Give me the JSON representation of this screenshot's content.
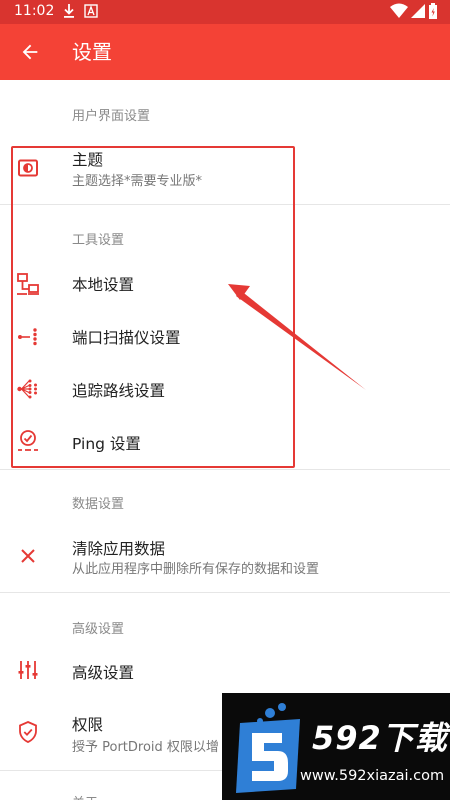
{
  "status_bar": {
    "time": "11:02",
    "background_color": "#d9342f",
    "left_icons": [
      "download-icon",
      "font-a-icon"
    ],
    "right_icons": [
      "wifi-icon",
      "signal-icon",
      "battery-icon"
    ]
  },
  "app_bar": {
    "title": "设置",
    "back_icon": "arrow-back-icon",
    "color": "#f44236"
  },
  "accent_color": "#e53935",
  "sections": {
    "ui": {
      "header": "用户界面设置",
      "theme": {
        "title": "主题",
        "summary": "主题选择*需要专业版*",
        "icon": "theme-icon"
      }
    },
    "tools": {
      "header": "工具设置",
      "local": {
        "title": "本地设置",
        "icon": "network-icon"
      },
      "port_scanner": {
        "title": "端口扫描仪设置",
        "icon": "port-scan-icon"
      },
      "traceroute": {
        "title": "追踪路线设置",
        "icon": "traceroute-icon"
      },
      "ping": {
        "title": "Ping 设置",
        "icon": "ping-icon"
      }
    },
    "data": {
      "header": "数据设置",
      "clear": {
        "title": "清除应用数据",
        "summary": "从此应用程序中删除所有保存的数据和设置",
        "icon": "close-icon"
      }
    },
    "advanced": {
      "header": "高级设置",
      "advanced_item": {
        "title": "高级设置",
        "icon": "sliders-icon"
      },
      "permissions": {
        "title": "权限",
        "summary": "授予 PortDroid 权限以增",
        "icon": "shield-check-icon"
      }
    },
    "about": {
      "header": "关于"
    }
  },
  "watermark": {
    "brand": "592下载",
    "url": "www.592xiazai.com"
  }
}
